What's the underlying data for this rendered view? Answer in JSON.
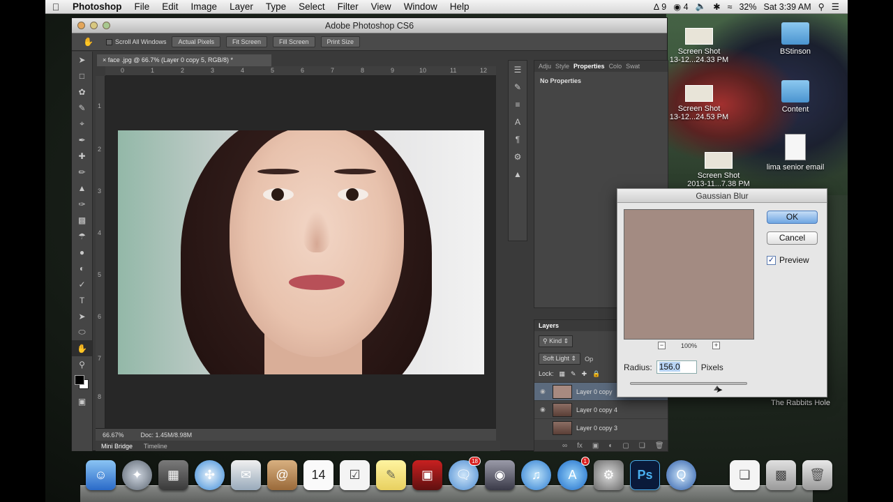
{
  "menubar": {
    "app": "Photoshop",
    "items": [
      "File",
      "Edit",
      "Image",
      "Layer",
      "Type",
      "Select",
      "Filter",
      "View",
      "Window",
      "Help"
    ],
    "status": {
      "adobe": "9",
      "cc": "4",
      "battery": "32%",
      "time": "Sat 3:39 AM"
    }
  },
  "window": {
    "title": "Adobe Photoshop CS6",
    "options": {
      "scroll_all": "Scroll All Windows",
      "actual": "Actual Pixels",
      "fit": "Fit Screen",
      "fill": "Fill Screen",
      "print": "Print Size"
    },
    "doc_tab": "face .jpg @ 66.7% (Layer 0 copy 5, RGB/8) *",
    "ruler_h": [
      "0",
      "1",
      "2",
      "3",
      "4",
      "5",
      "6",
      "7",
      "8",
      "9",
      "10",
      "11",
      "12"
    ],
    "ruler_v": [
      "1",
      "2",
      "3",
      "4",
      "5",
      "6",
      "7",
      "8"
    ],
    "zoom": "66.67%",
    "doc_size": "Doc: 1.45M/8.98M",
    "mini_tabs": [
      "Mini Bridge",
      "Timeline"
    ]
  },
  "properties": {
    "tabs": [
      "Adju",
      "Style",
      "Properties",
      "Colo",
      "Swat"
    ],
    "empty": "No Properties"
  },
  "layers": {
    "title": "Layers",
    "kind": "Kind",
    "blend": "Soft Light",
    "opacity_label": "Op",
    "lock_label": "Lock:",
    "items": [
      "Layer 0 copy",
      "Layer 0 copy 4",
      "Layer 0 copy 3"
    ]
  },
  "desktop": {
    "icons": [
      {
        "label": "BStinson"
      },
      {
        "label": "Content"
      },
      {
        "label": "lima senior email"
      },
      {
        "label": "Screen Shot",
        "sub": "13-12...24.33 PM"
      },
      {
        "label": "Screen Shot",
        "sub": "13-12...24.53 PM"
      },
      {
        "label": "Screen Shot",
        "sub": "2013-11...7.38 PM"
      }
    ],
    "watermark": "The Rabbits Hole"
  },
  "dialog": {
    "title": "Gaussian Blur",
    "ok": "OK",
    "cancel": "Cancel",
    "preview_label": "Preview",
    "zoom": "100%",
    "radius_label": "Radius:",
    "radius_value": "156.0",
    "unit": "Pixels",
    "preview_color": "#a38b82"
  },
  "dock": {
    "calendar_day": "14",
    "messages_badge": "18",
    "appstore_badge": "1",
    "ps_label": "Ps"
  }
}
